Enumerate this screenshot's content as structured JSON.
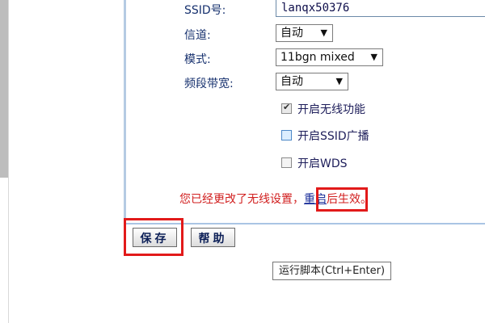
{
  "form": {
    "ssid_label": "SSID号:",
    "ssid_value": "lanqx50376",
    "channel_label": "信道:",
    "channel_value": "自动",
    "mode_label": "模式:",
    "mode_value": "11bgn mixed",
    "bandwidth_label": "频段带宽:",
    "bandwidth_value": "自动",
    "arrow": "▼"
  },
  "checkboxes": [
    {
      "label": "开启无线功能",
      "checked": true
    },
    {
      "label": "开启SSID广播",
      "checked": false
    },
    {
      "label": "开启WDS",
      "checked": false
    }
  ],
  "notice": {
    "before": "您已经更改了无线设置，",
    "link": "重启",
    "after": "后生效。"
  },
  "buttons": {
    "save": "保存",
    "help": "帮助"
  },
  "tooltip": {
    "text": "运行脚本(Ctrl+Enter)"
  },
  "colors": {
    "highlight": "#e21a1a",
    "notice": "#d11e1e",
    "label": "#16306e"
  }
}
